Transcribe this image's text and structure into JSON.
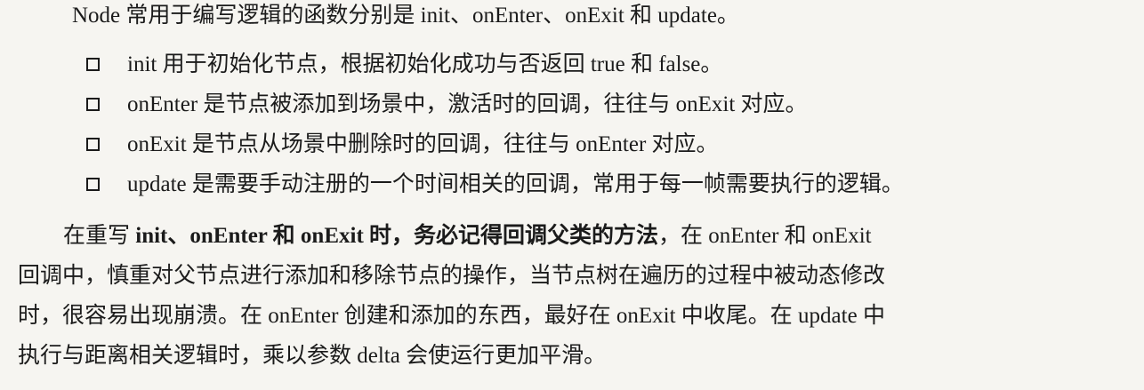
{
  "intro": "Node 常用于编写逻辑的函数分别是 init、onEnter、onExit 和 update。",
  "bullets": [
    "init 用于初始化节点，根据初始化成功与否返回 true 和 false。",
    "onEnter 是节点被添加到场景中，激活时的回调，往往与 onExit 对应。",
    "onExit 是节点从场景中删除时的回调，往往与 onEnter 对应。",
    "update 是需要手动注册的一个时间相关的回调，常用于每一帧需要执行的逻辑。"
  ],
  "paragraph": {
    "lead": "在重写 ",
    "bold": "init、onEnter 和 onExit 时，务必记得回调父类的方法",
    "line1_rest": "，在 onEnter 和 onExit",
    "line2": "回调中，慎重对父节点进行添加和移除节点的操作，当节点树在遍历的过程中被动态修改",
    "line3": "时，很容易出现崩溃。在 onEnter 创建和添加的东西，最好在 onExit 中收尾。在 update 中",
    "line4": "执行与距离相关逻辑时，乘以参数 delta 会使运行更加平滑。"
  }
}
